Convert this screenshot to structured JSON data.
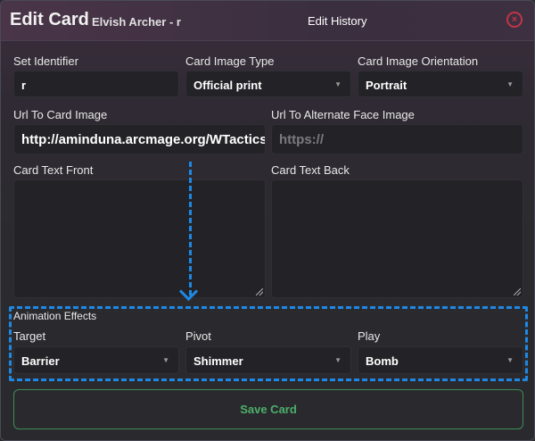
{
  "header": {
    "title": "Edit Card",
    "subtitle": "Elvish Archer - r",
    "history_label": "Edit History",
    "close_glyph": "×"
  },
  "form": {
    "set_identifier": {
      "label": "Set Identifier",
      "value": "r"
    },
    "card_image_type": {
      "label": "Card Image Type",
      "value": "Official print"
    },
    "card_image_orientation": {
      "label": "Card Image Orientation",
      "value": "Portrait"
    },
    "url_card_image": {
      "label": "Url To Card Image",
      "value": "http://aminduna.arcmage.org/WTactics/"
    },
    "url_alternate_face": {
      "label": "Url To Alternate Face Image",
      "placeholder": "https://"
    },
    "card_text_front": {
      "label": "Card Text Front",
      "value": ""
    },
    "card_text_back": {
      "label": "Card Text Back",
      "value": ""
    }
  },
  "animation": {
    "section_label": "Animation Effects",
    "target": {
      "label": "Target",
      "value": "Barrier"
    },
    "pivot": {
      "label": "Pivot",
      "value": "Shimmer"
    },
    "play": {
      "label": "Play",
      "value": "Bomb"
    }
  },
  "save_label": "Save Card",
  "colors": {
    "highlight": "#1e88e5",
    "save_text": "#4caf6a",
    "close": "#c0344a"
  },
  "icons": [
    "close-icon",
    "caret-down-icon",
    "resize-grip-icon",
    "arrow-down-icon"
  ]
}
